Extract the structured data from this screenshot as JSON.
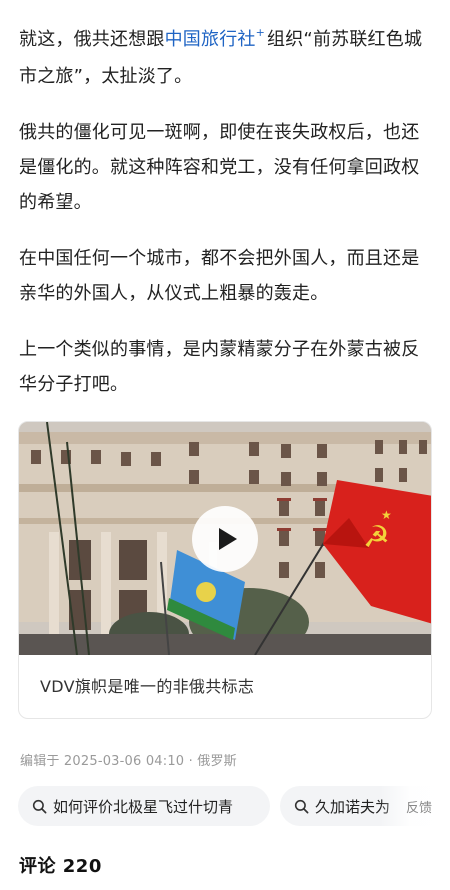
{
  "article": {
    "p1_before": "就这，俄共还想跟",
    "p1_link": "中国旅行社",
    "p1_mark": "+",
    "p1_after": "组织“前苏联红色城市之旅”，太扯淡了。",
    "p2": "俄共的僵化可见一斑啊，即使在丧失政权后，也还是僵化的。就这种阵容和党工，没有任何拿回政权的希望。",
    "p3": "在中国任何一个城市，都不会把外国人，而且还是亲华的外国人，从仪式上粗暴的轰走。",
    "p4": "上一个类似的事情，是内蒙精蒙分子在外蒙古被反华分子打吧。"
  },
  "video": {
    "caption": "VDV旗帜是唯一的非俄共标志",
    "flag_symbol": "☭",
    "flag_star": "★"
  },
  "meta": {
    "text": "编辑于 2025-03-06 04:10 · 俄罗斯"
  },
  "chips": [
    {
      "label": "如何评价北极星飞过什切青"
    },
    {
      "label": "久加诺夫为"
    }
  ],
  "feedback": "反馈",
  "comments": {
    "label": "评论 220"
  },
  "colors": {
    "link": "#1f64c4",
    "flag_red": "#d8211c",
    "flag_blue": "#3f8fd6"
  }
}
